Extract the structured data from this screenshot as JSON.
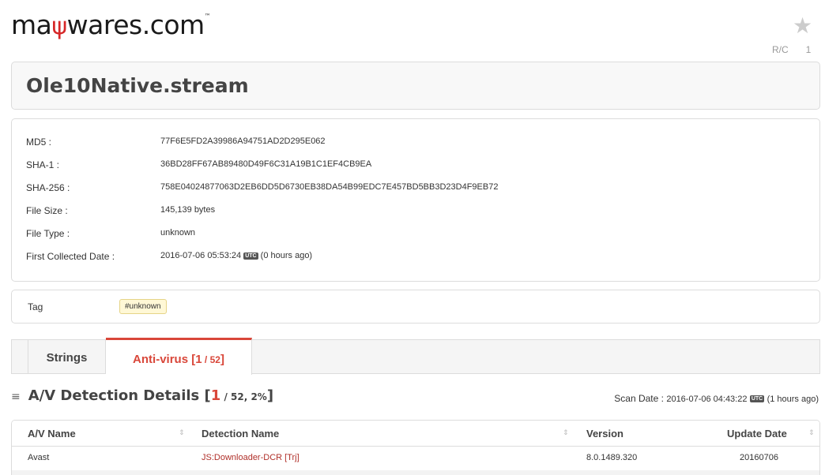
{
  "header": {
    "logo_pre": "ma",
    "logo_fork": "ψ",
    "logo_post": "wares.com",
    "logo_tm": "™",
    "rc_label": "R/C",
    "rc_count": "1"
  },
  "title": "Ole10Native.stream",
  "info": {
    "rows": [
      {
        "label": "MD5 :",
        "value": "77F6E5FD2A39986A94751AD2D295E062"
      },
      {
        "label": "SHA-1 :",
        "value": "36BD28FF67AB89480D49F6C31A19B1C1EF4CB9EA"
      },
      {
        "label": "SHA-256 :",
        "value": "758E04024877063D2EB6DD5D6730EB38DA54B99EDC7E457BD5BB3D23D4F9EB72"
      },
      {
        "label": "File Size :",
        "value": "145,139 bytes"
      },
      {
        "label": "File Type :",
        "value": "unknown"
      }
    ],
    "collected_label": "First Collected Date :",
    "collected_value": "2016-07-06 05:53:24",
    "collected_utc": "UTC",
    "collected_ago": "(0 hours ago)"
  },
  "tag": {
    "label": "Tag",
    "chip": "#unknown"
  },
  "tabs": {
    "strings": "Strings",
    "av_label": "Anti-virus [",
    "av_hits": "1",
    "av_sep": " / ",
    "av_total": "52",
    "av_close": "]"
  },
  "detection": {
    "menu_icon": "≡",
    "title": "A/V Detection Details [",
    "hits": "1",
    "rest": " / 52, 2%",
    "close": "]",
    "scan_label": "Scan Date :",
    "scan_value": "2016-07-06 04:43:22",
    "scan_utc": "UTC",
    "scan_ago": "(1 hours ago)"
  },
  "table": {
    "headers": {
      "name": "A/V Name",
      "detection": "Detection Name",
      "version": "Version",
      "update": "Update Date"
    },
    "rows": [
      {
        "name": "Avast",
        "detection": "JS:Downloader-DCR [Trj]",
        "version": "8.0.1489.320",
        "update": "20160706"
      }
    ]
  },
  "colors": {
    "accent": "#d9473a",
    "tag_bg": "#fff8d6"
  }
}
